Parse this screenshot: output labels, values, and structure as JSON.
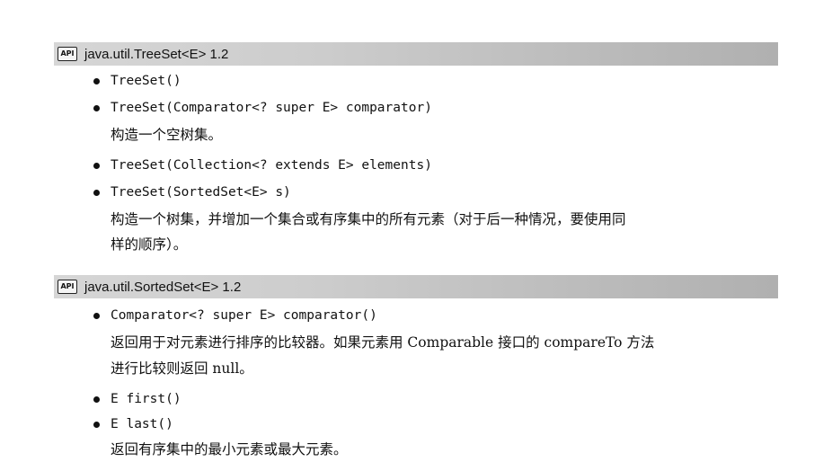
{
  "sections": [
    {
      "badge": "API",
      "title": "java.util.TreeSet<E> 1.2",
      "methods": [
        "TreeSet()",
        "TreeSet(Comparator<? super E> comparator)",
        "TreeSet(Collection<? extends E> elements)",
        "TreeSet(SortedSet<E> s)"
      ],
      "descriptions": [
        "构造一个空树集。",
        "构造一个树集，并增加一个集合或有序集中的所有元素（对于后一种情况，要使用同",
        "样的顺序）。"
      ]
    },
    {
      "badge": "API",
      "title": "java.util.SortedSet<E> 1.2",
      "methods": [
        "Comparator<? super E> comparator()",
        "E first()",
        "E last()"
      ],
      "descriptions": [
        "返回用于对元素进行排序的比较器。如果元素用 Comparable 接口的 compareTo 方法",
        "进行比较则返回 null。",
        "返回有序集中的最小元素或最大元素。"
      ]
    }
  ]
}
